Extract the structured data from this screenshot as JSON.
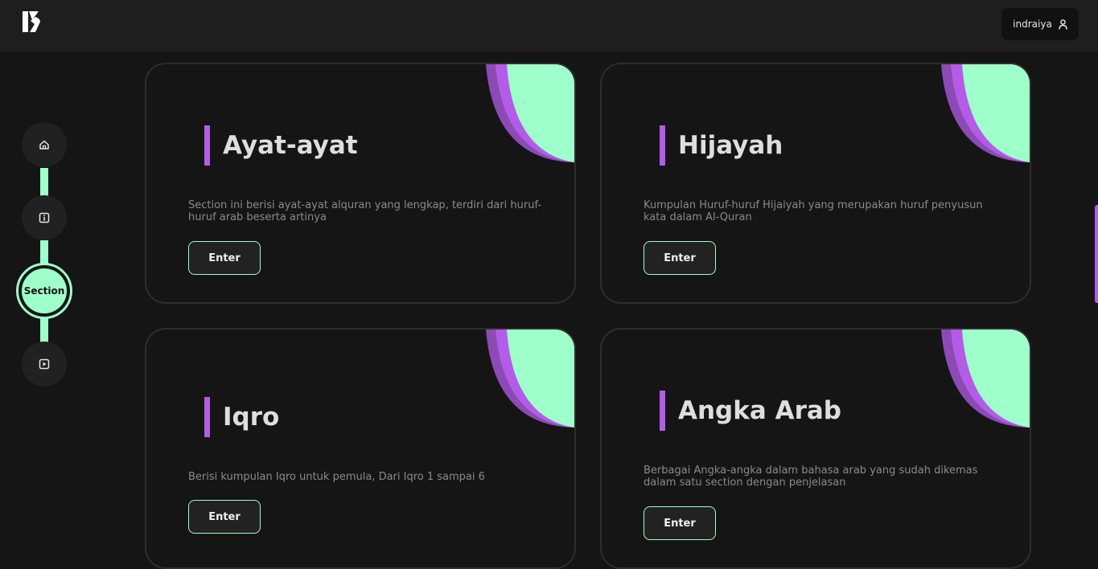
{
  "header": {
    "username": "indraiya",
    "logo_icon": "k-logo",
    "user_icon": "user-icon"
  },
  "sidenav": {
    "items": [
      {
        "icon": "home-icon"
      },
      {
        "icon": "info-icon"
      },
      {
        "label": "Section"
      },
      {
        "icon": "play-icon"
      }
    ]
  },
  "cards": [
    {
      "title": "Ayat-ayat",
      "description": "Section ini berisi ayat-ayat alquran yang lengkap, terdiri dari huruf-huruf arab beserta artinya",
      "button": "Enter"
    },
    {
      "title": "Hijayah",
      "description": "Kumpulan Huruf-huruf Hijaiyah yang merupakan huruf penyusun kata dalam Al-Quran",
      "button": "Enter"
    },
    {
      "title": "Iqro",
      "description": "Berisi kumpulan Iqro untuk pemula, Dari Iqro 1 sampai 6",
      "button": "Enter"
    },
    {
      "title": "Angka Arab",
      "description": "Berbagai Angka-angka dalam bahasa arab yang sudah dikemas dalam satu section dengan penjelasan",
      "button": "Enter"
    }
  ],
  "colors": {
    "accent_green": "#9effca",
    "accent_purple": "#b45ce8",
    "background": "#151515",
    "topbar": "#1e1e1e"
  }
}
